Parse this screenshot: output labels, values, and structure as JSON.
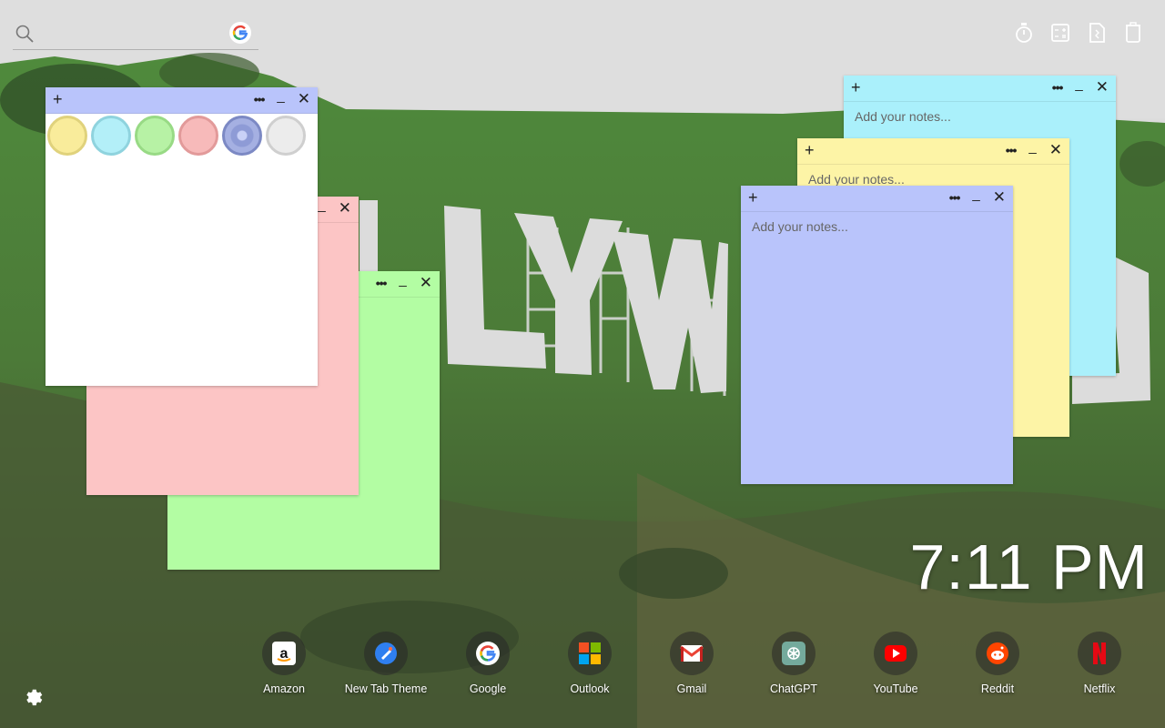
{
  "search": {
    "placeholder": ""
  },
  "top_tools": [
    {
      "name": "timer-icon"
    },
    {
      "name": "calculator-icon"
    },
    {
      "name": "document-icon"
    },
    {
      "name": "trash-icon"
    }
  ],
  "notes": {
    "placeholder": "Add your notes...",
    "plus": "+",
    "more": "•••",
    "minimize": "_",
    "close": "✕",
    "colors": [
      "#f9ec9b",
      "#b3eff8",
      "#b7f2a5",
      "#f7baba",
      "#8e9bd6",
      "#ececec"
    ]
  },
  "clock": "7:11 PM",
  "shortcuts": [
    {
      "label": "Amazon"
    },
    {
      "label": "New Tab Theme"
    },
    {
      "label": "Google"
    },
    {
      "label": "Outlook"
    },
    {
      "label": "Gmail"
    },
    {
      "label": "ChatGPT"
    },
    {
      "label": "YouTube"
    },
    {
      "label": "Reddit"
    },
    {
      "label": "Netflix"
    }
  ],
  "palette": {
    "note_yellow": "#fdf4a6",
    "note_cyan": "#aaf0fb",
    "note_green": "#b3fda3",
    "note_pink": "#fcc5c5",
    "note_blue": "#b9c4fb",
    "note_white": "#ffffff"
  }
}
